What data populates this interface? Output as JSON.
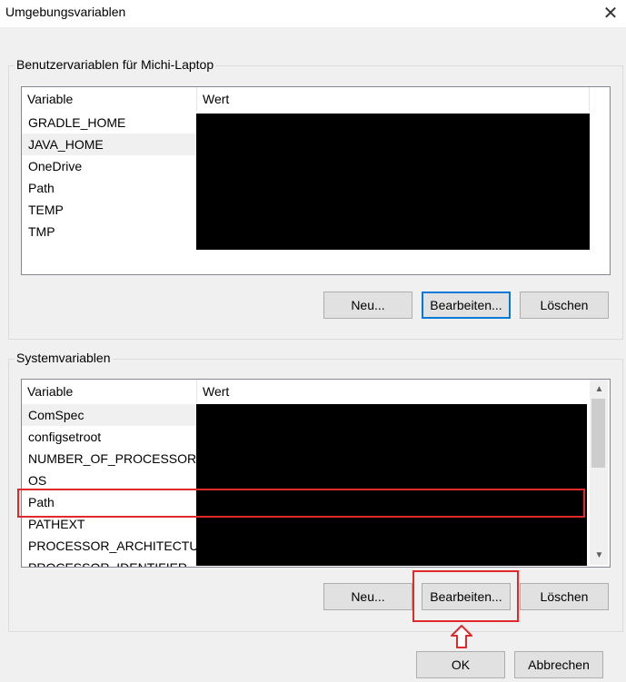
{
  "window": {
    "title": "Umgebungsvariablen"
  },
  "user_group": {
    "label": "Benutzervariablen für Michi-Laptop",
    "columns": [
      "Variable",
      "Wert"
    ],
    "rows": [
      "GRADLE_HOME",
      "JAVA_HOME",
      "OneDrive",
      "Path",
      "TEMP",
      "TMP"
    ],
    "selected_row": "JAVA_HOME",
    "buttons": {
      "new": "Neu...",
      "edit": "Bearbeiten...",
      "delete": "Löschen"
    }
  },
  "system_group": {
    "label": "Systemvariablen",
    "columns": [
      "Variable",
      "Wert"
    ],
    "rows": [
      "ComSpec",
      "configsetroot",
      "NUMBER_OF_PROCESSORS",
      "OS",
      "Path",
      "PATHEXT",
      "PROCESSOR_ARCHITECTU...",
      "PROCESSOR_IDENTIFIER"
    ],
    "selected_row": "ComSpec",
    "highlighted_row": "Path",
    "buttons": {
      "new": "Neu...",
      "edit": "Bearbeiten...",
      "delete": "Löschen"
    }
  },
  "dialog_buttons": {
    "ok": "OK",
    "cancel": "Abbrechen"
  },
  "icons": {
    "close": "close-icon",
    "scroll_up": "chevron-up-icon",
    "scroll_down": "chevron-down-icon",
    "annotation_arrow": "arrow-up-icon"
  },
  "colors": {
    "annotation": "#e0292b",
    "focus": "#0078d7"
  }
}
